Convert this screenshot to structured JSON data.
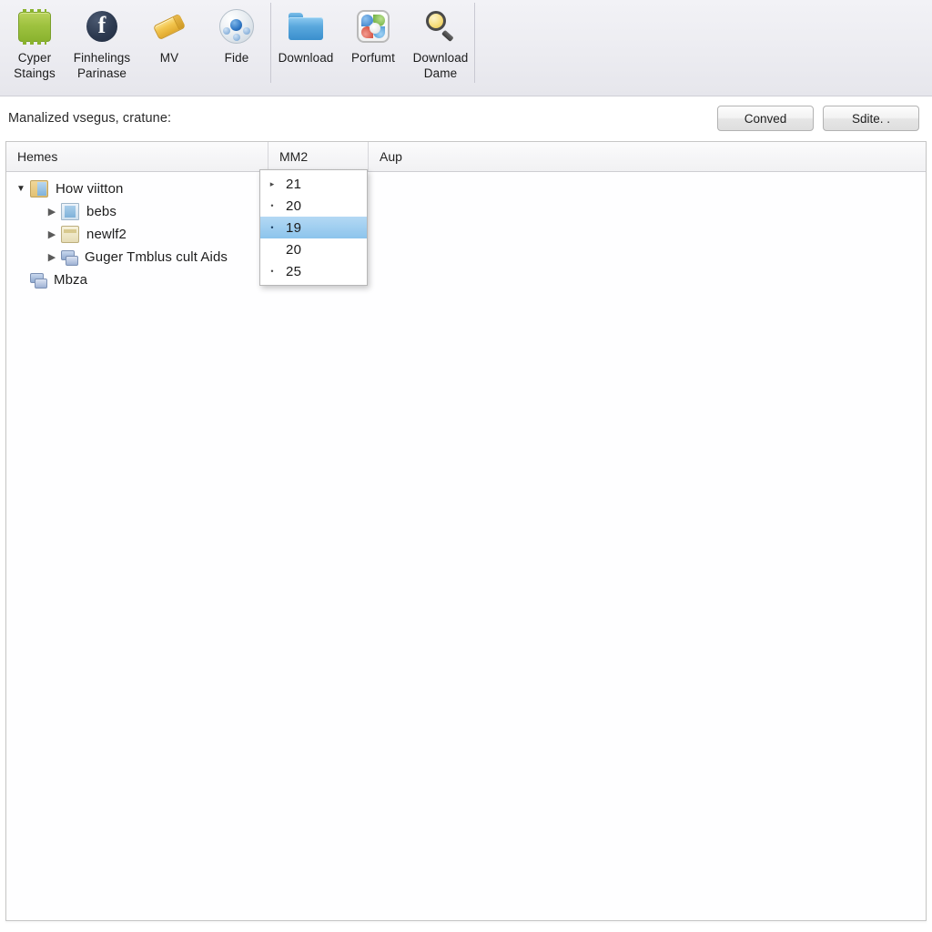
{
  "toolbar": {
    "groups": [
      {
        "items": [
          {
            "label": "Cyper Staings",
            "icon": "chip-icon",
            "name": "toolbar-button-cyper-staings"
          },
          {
            "label": "Finhelings Parinase",
            "icon": "facebook-icon",
            "name": "toolbar-button-finhelings-parinase"
          },
          {
            "label": "MV",
            "icon": "pencil-icon",
            "name": "toolbar-button-mv"
          },
          {
            "label": "Fide",
            "icon": "molecule-globe-icon",
            "name": "toolbar-button-fide"
          }
        ]
      },
      {
        "items": [
          {
            "label": "Download",
            "icon": "folder-icon",
            "name": "toolbar-button-download"
          },
          {
            "label": "Porfumt",
            "icon": "pinwheel-icon",
            "name": "toolbar-button-porfumt"
          },
          {
            "label": "Download Dame",
            "icon": "magnifier-icon",
            "name": "toolbar-button-download-dame"
          }
        ]
      }
    ]
  },
  "subbar": {
    "label": "Manalized vsegus, cratune:",
    "buttons": [
      {
        "label": "Conved",
        "name": "conved-button"
      },
      {
        "label": "Sdite. .",
        "name": "sdite-button"
      }
    ]
  },
  "list": {
    "columns": [
      {
        "label": "Hemes",
        "active": false
      },
      {
        "label": "MM2",
        "active": true
      },
      {
        "label": "Aup",
        "active": false
      }
    ],
    "rows": [
      {
        "label": "How viitton",
        "depth": 1,
        "twisty": "open",
        "icon": "folder-icon"
      },
      {
        "label": "bebs",
        "depth": 2,
        "twisty": "closed",
        "icon": "document-icon"
      },
      {
        "label": "newlf2",
        "depth": 2,
        "twisty": "closed",
        "icon": "jar-icon"
      },
      {
        "label": "Guger Tmblus cult Aids",
        "depth": 2,
        "twisty": "closed",
        "icon": "cluster-icon"
      },
      {
        "label": "Mbza",
        "depth": 1,
        "twisty": "none",
        "icon": "cluster-icon"
      }
    ]
  },
  "dropdown": {
    "items": [
      {
        "value": "21",
        "marker": "▸",
        "selected": false
      },
      {
        "value": "20",
        "marker": "•",
        "selected": false
      },
      {
        "value": "19",
        "marker": "•",
        "selected": true
      },
      {
        "value": "20",
        "marker": "",
        "selected": false
      },
      {
        "value": "25",
        "marker": "•",
        "selected": false
      }
    ]
  },
  "colors": {
    "toolbar_bg": "#ececf1",
    "selection_blue": "#8cc4ec",
    "active_column_underline": "#4a9edb",
    "panel_border": "#c6c6c6"
  }
}
